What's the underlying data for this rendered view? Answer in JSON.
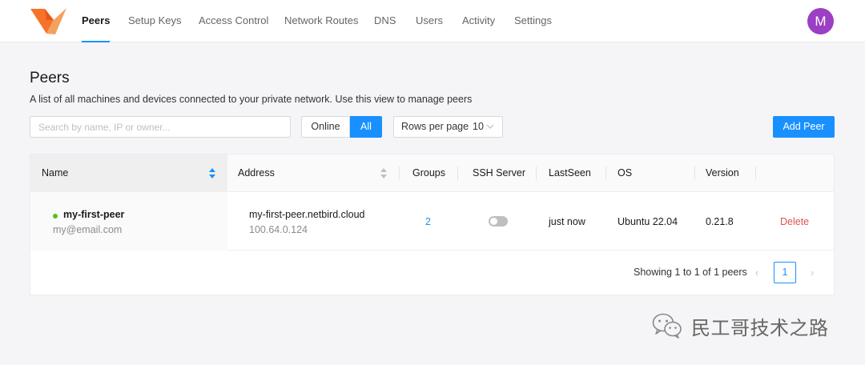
{
  "nav": {
    "items": [
      {
        "label": "Peers",
        "active": true
      },
      {
        "label": "Setup Keys"
      },
      {
        "label": "Access Control"
      },
      {
        "label": "Network Routes"
      },
      {
        "label": "DNS"
      },
      {
        "label": "Users"
      },
      {
        "label": "Activity"
      },
      {
        "label": "Settings"
      }
    ],
    "avatar_initial": "M",
    "avatar_color": "#9b3fc4"
  },
  "header": {
    "title": "Peers",
    "description": "A list of all machines and devices connected to your private network. Use this view to manage peers"
  },
  "toolbar": {
    "search_placeholder": "Search by name, IP or owner...",
    "filter_online": "Online",
    "filter_all": "All",
    "filter_selected": "All",
    "rows_per_page_label": "Rows per page",
    "rows_per_page_value": "10",
    "add_button": "Add Peer"
  },
  "table": {
    "columns": [
      "Name",
      "Address",
      "Groups",
      "SSH Server",
      "LastSeen",
      "OS",
      "Version"
    ],
    "rows": [
      {
        "status": "online",
        "name": "my-first-peer",
        "email": "my@email.com",
        "address_dns": "my-first-peer.netbird.cloud",
        "address_ip": "100.64.0.124",
        "groups": "2",
        "ssh_server_enabled": false,
        "last_seen": "just now",
        "os": "Ubuntu 22.04",
        "version": "0.21.8",
        "action": "Delete"
      }
    ]
  },
  "pagination": {
    "summary": "Showing 1 to 1 of 1 peers",
    "current_page": "1",
    "prev": "‹",
    "next": "›"
  },
  "watermark": {
    "text": "民工哥技术之路",
    "icon": "wechat-icon"
  },
  "colors": {
    "accent": "#1890ff",
    "online": "#52c41a",
    "danger": "#e05252",
    "logo": "#f6742a"
  }
}
